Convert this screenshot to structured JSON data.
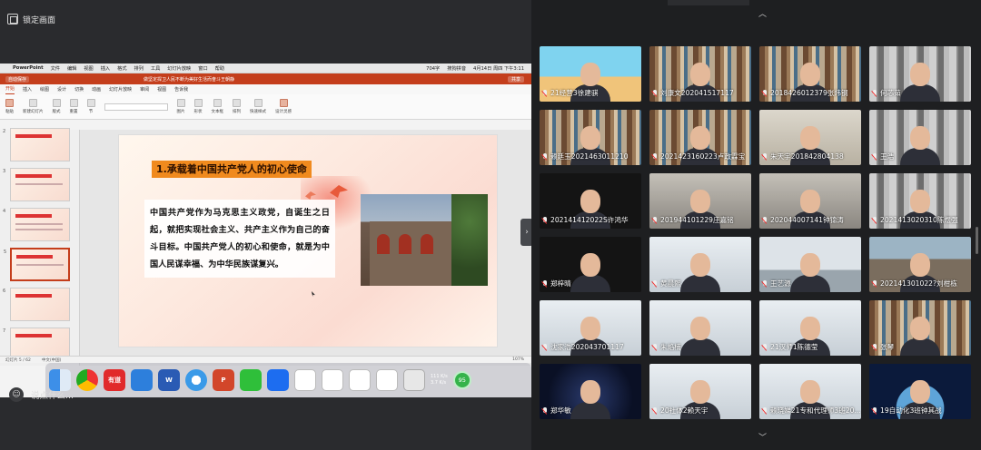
{
  "share": {
    "lock_label": "锁定画面",
    "mac_menubar": {
      "app": "PowerPoint",
      "items": [
        "文件",
        "编辑",
        "视图",
        "插入",
        "格式",
        "排列",
        "工具",
        "幻灯片放映",
        "窗口",
        "帮助"
      ],
      "right": [
        "704字",
        "搜狗拼音",
        "4月14日 周四 下午3:11"
      ]
    },
    "titlebar": {
      "autosave": "自动保存",
      "doc": "做坚定捍卫人民不断为美好生活而奋斗王朝静",
      "share": "共享"
    },
    "ribbon_tabs": [
      "开始",
      "插入",
      "绘图",
      "设计",
      "切换",
      "动画",
      "幻灯片放映",
      "审阅",
      "视图",
      "告诉我"
    ],
    "ribbon_groups": [
      "粘贴",
      "新建幻灯片",
      "版式",
      "重置",
      "节",
      "图片",
      "形状",
      "文本框",
      "排列",
      "快速样式",
      "设计灵感"
    ],
    "slide": {
      "title": "1.承载着中国共产党人的初心使命",
      "body": "中国共产党作为马克思主义政党，自诞生之日起，就把实现社会主义、共产主义作为自己的奋斗目标。中国共产党人的初心和使命，就是为中国人民谋幸福、为中华民族谋复兴。"
    },
    "thumb_numbers": [
      "2",
      "3",
      "4",
      "5",
      "6",
      "7"
    ],
    "status": {
      "slide": "幻灯片 5 / 62",
      "lang": "中文(中国)",
      "zoom": "107%"
    },
    "dock": {
      "youdao": "有道",
      "speed_up": "111 K/s",
      "speed_down": "3.7 K/s",
      "percent": "95"
    },
    "chat_placeholder": "说点什么..."
  },
  "participants": [
    {
      "name": "21经营3徐建骐"
    },
    {
      "name": "刘康文202041517117"
    },
    {
      "name": "2018426012379张炜钢"
    },
    {
      "name": "何芯茹"
    },
    {
      "name": "赖廷玉2021463011210"
    },
    {
      "name": "2021423160223卢政霖宝"
    },
    {
      "name": "朱天宇201842804138"
    },
    {
      "name": "王浩"
    },
    {
      "name": "202141412022S许鸿华"
    },
    {
      "name": "201944101229庄嘉铭"
    },
    {
      "name": "202044007141钟锦涛"
    },
    {
      "name": "2021413020310陈煜强"
    },
    {
      "name": "郑梓晴"
    },
    {
      "name": "黄晨熙"
    },
    {
      "name": "王艺源"
    },
    {
      "name": "202141301022?刘柑栋"
    },
    {
      "name": "沈家浩202043701117"
    },
    {
      "name": "朱焰楠"
    },
    {
      "name": "21汉师1陈德莹"
    },
    {
      "name": "张琴"
    },
    {
      "name": "郑华敏"
    },
    {
      "name": "20社体2赖天宇"
    },
    {
      "name": "赖晓娣21专和代理师3班20..."
    },
    {
      "name": "19自动化3班钟其战"
    }
  ],
  "colors": {
    "accent": "#c43e1c",
    "title_bar": "#f08a1e"
  }
}
